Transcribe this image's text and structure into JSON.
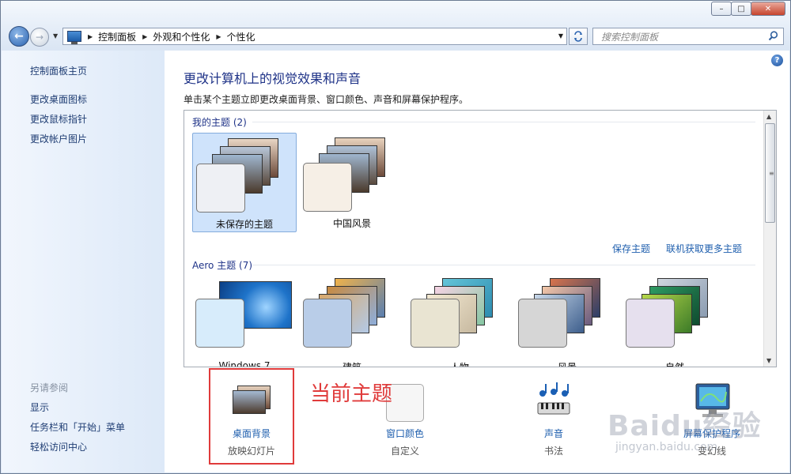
{
  "window": {
    "min": "–",
    "max": "□",
    "close": "✕"
  },
  "nav": {
    "back": "←",
    "forward": "→"
  },
  "breadcrumb": [
    "控制面板",
    "外观和个性化",
    "个性化"
  ],
  "search": {
    "placeholder": "搜索控制面板"
  },
  "sidebar": {
    "links": [
      "控制面板主页",
      "更改桌面图标",
      "更改鼠标指针",
      "更改帐户图片"
    ],
    "see_also_title": "另请参阅",
    "see_also": [
      "显示",
      "任务栏和「开始」菜单",
      "轻松访问中心"
    ]
  },
  "main": {
    "help": "?",
    "title": "更改计算机上的视觉效果和声音",
    "subtitle": "单击某个主题立即更改桌面背景、窗口颜色、声音和屏幕保护程序。",
    "my_themes": {
      "title": "我的主题 (2)",
      "items": [
        {
          "label": "未保存的主题",
          "selected": true,
          "color": "#eef0f4"
        },
        {
          "label": "中国风景",
          "selected": false,
          "color": "#f6efe6"
        }
      ],
      "save_link": "保存主题",
      "online_link": "联机获取更多主题"
    },
    "aero_themes": {
      "title": "Aero 主题 (7)",
      "items": [
        {
          "label": "Windows 7",
          "color": "#d7ecfb"
        },
        {
          "label": "建筑",
          "color": "#b9cde8"
        },
        {
          "label": "人物",
          "color": "#e9e4d2"
        },
        {
          "label": "风景",
          "color": "#d6d6d6"
        },
        {
          "label": "自然",
          "color": "#e6e0ee"
        }
      ]
    }
  },
  "bottom": [
    {
      "label": "桌面背景",
      "sub": "放映幻灯片"
    },
    {
      "label": "窗口颜色",
      "sub": "自定义"
    },
    {
      "label": "声音",
      "sub": "书法"
    },
    {
      "label": "屏幕保护程序",
      "sub": "变幻线"
    }
  ],
  "annotation": "当前主题",
  "watermark": {
    "main": "Baidu经验",
    "sub": "jingyan.baidu.com"
  },
  "colors": {
    "accent": "#1e3287",
    "link": "#1f5fae",
    "highlight": "#e03b3b"
  }
}
